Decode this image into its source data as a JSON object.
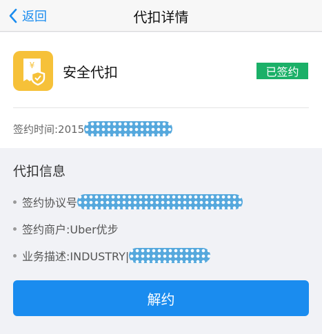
{
  "header": {
    "back_label": "返回",
    "title": "代扣详情"
  },
  "service": {
    "icon": "shield-receipt-icon",
    "name": "安全代扣",
    "status": "已签约",
    "sign_time_label": "签约时间:2015"
  },
  "info": {
    "title": "代扣信息",
    "rows": [
      {
        "text": "签约协议号"
      },
      {
        "text": "签约商户:Uber优步"
      },
      {
        "text": "业务描述:INDUSTRY|"
      }
    ]
  },
  "actions": {
    "cancel_label": "解约"
  },
  "colors": {
    "accent": "#1a8cef",
    "status_green": "#1bb068",
    "icon_yellow": "#f6c139",
    "redaction_blue": "#55a8dd"
  }
}
